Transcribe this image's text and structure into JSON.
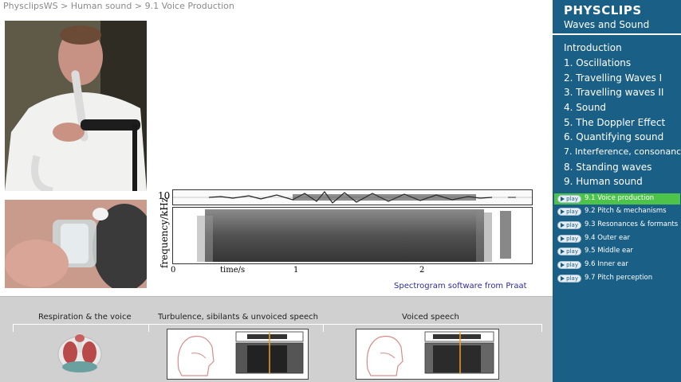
{
  "breadcrumb": {
    "items": [
      "PhysclipsWS",
      "Human sound",
      "9.1 Voice Production"
    ],
    "sep": ">"
  },
  "brand": {
    "title": "PHYSCLIPS",
    "subtitle": "Waves and Sound"
  },
  "chapters": [
    "Introduction",
    "1. Oscillations",
    "2. Travelling Waves I",
    "3. Travelling waves II",
    "4. Sound",
    "5. The Doppler Effect",
    "6. Quantifying sound",
    "7. Interference, consonance",
    "8. Standing waves",
    "9. Human sound"
  ],
  "subchapters": {
    "play_label": "play",
    "items": [
      {
        "label": "9.1 Voice production",
        "active": true
      },
      {
        "label": "9.2 Pitch & mechanisms",
        "active": false
      },
      {
        "label": "9.3 Resonances & formants",
        "active": false
      },
      {
        "label": "9.4 Outer ear",
        "active": false
      },
      {
        "label": "9.5 Middle ear",
        "active": false
      },
      {
        "label": "9.6 Inner ear",
        "active": false
      },
      {
        "label": "9.7 Pitch perception",
        "active": false
      }
    ]
  },
  "spectrogram": {
    "y_top_label": "10",
    "y_axis_label": "frequency/kHz",
    "x_ticks": [
      "0",
      "time/s",
      "1",
      "2"
    ],
    "credit": "Spectrogram software from Praat"
  },
  "sections": [
    "Respiration & the voice",
    "Turbulence, sibilants & unvoiced speech",
    "Voiced speech"
  ],
  "colors": {
    "sidebar_bg": "#1a5f85",
    "active_item": "#4dc34a",
    "bottom_bg": "#d0d0d0",
    "credit_text": "#2c2c9a"
  }
}
